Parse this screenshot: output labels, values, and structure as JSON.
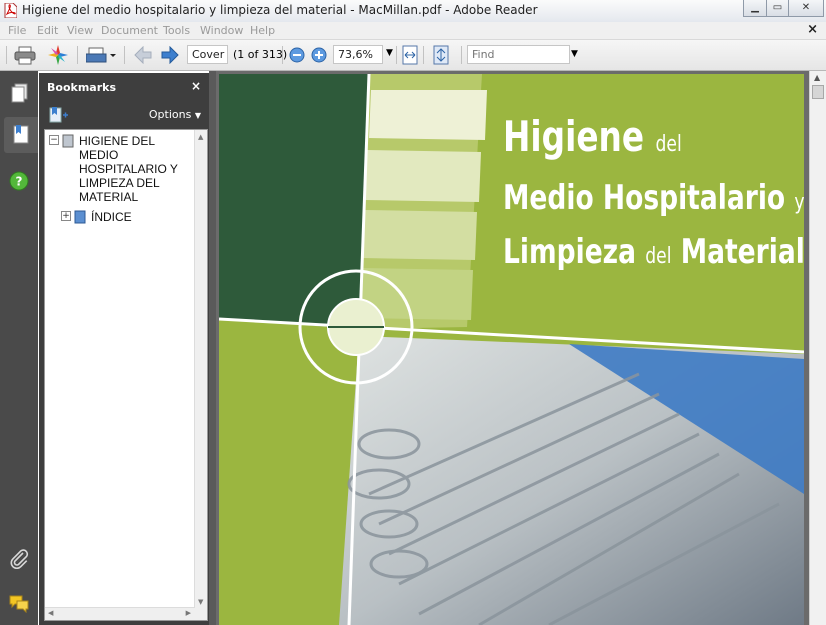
{
  "window": {
    "title": "Higiene del medio hospitalario y limpieza del material - MacMillan.pdf - Adobe Reader"
  },
  "menu": {
    "items": [
      "File",
      "Edit",
      "View",
      "Document",
      "Tools",
      "Window",
      "Help"
    ],
    "close_glyph": "×"
  },
  "toolbar": {
    "page_label": "Cover",
    "page_count": "(1 of 313)",
    "zoom": "73,6%",
    "find_placeholder": "Find"
  },
  "panel": {
    "title": "Bookmarks",
    "close_glyph": "×",
    "options_label": "Options",
    "bookmarks": [
      {
        "label": "HIGIENE DEL MEDIO HOSPITALARIO Y LIMPIEZA DEL MATERIAL",
        "expanded": true
      },
      {
        "label": "ÍNDICE",
        "expanded": false
      }
    ]
  },
  "cover": {
    "line1_big": "Higiene",
    "line1_small": "del",
    "line2_big": "Medio Hospitalario",
    "line2_small": "y",
    "line3_big": "Limpieza",
    "line3_small": "del",
    "line3_big2": "Material"
  },
  "colors": {
    "cover_green": "#9bb640",
    "cover_dark": "#2e5a3a",
    "panel_dark": "#3e3e3e"
  },
  "icons": [
    "pdf-icon",
    "print-icon",
    "collaborate-icon",
    "share-icon",
    "prev-page-icon",
    "next-page-icon",
    "zoom-out-icon",
    "zoom-in-icon",
    "fit-width-icon",
    "full-screen-icon",
    "pages-icon",
    "bookmarks-icon",
    "help-icon",
    "attachments-icon",
    "comments-icon"
  ]
}
